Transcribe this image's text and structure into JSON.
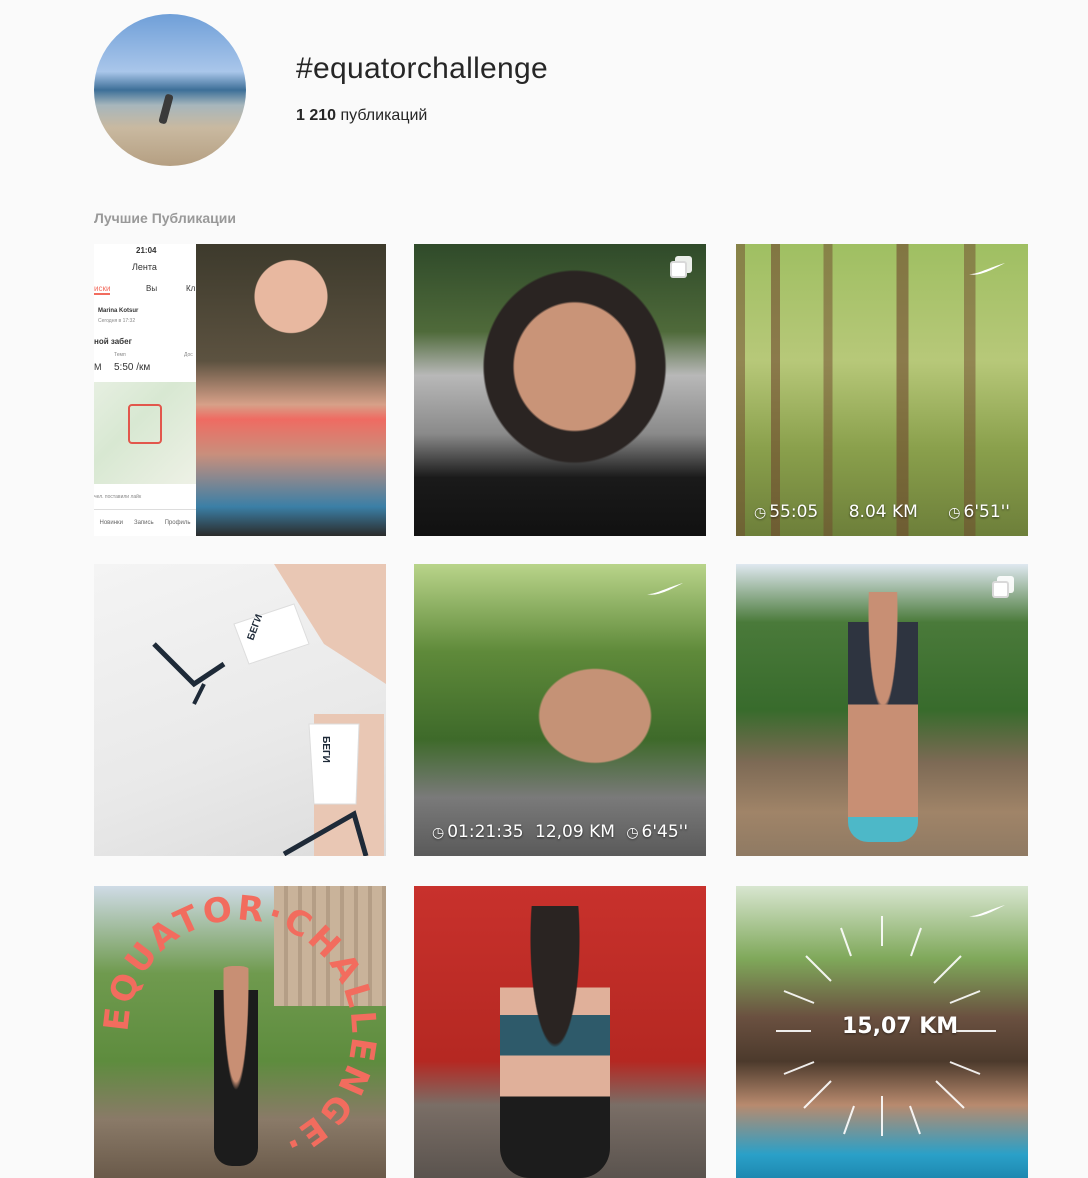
{
  "header": {
    "hashtag": "#equatorchallenge",
    "post_count": "1 210",
    "post_count_label": "публикаций"
  },
  "section": {
    "title": "Лучшие Публикации"
  },
  "posts": [
    {
      "phone": {
        "time": "21:04",
        "feed_tab": "Лента",
        "tabs": [
          "иски",
          "Вы",
          "Кл"
        ],
        "user": "Marina Kotsur",
        "date": "Сегодня в 17:32",
        "run_title": "ной забег",
        "pace_label": "Темп",
        "pace_unit_left": "М",
        "pace_value": "5:50 /км",
        "dist_label": "Дос",
        "likes_text": "чел. поставили лайк",
        "bottom_tabs": [
          "Новинки",
          "Запись",
          "Профиль"
        ]
      }
    },
    {
      "multi": true
    },
    {
      "stats": [
        "55:05",
        "8.04 KM",
        "6'51''"
      ]
    },
    {
      "sock_text": "БЕГИ"
    },
    {
      "stats": [
        "01:21:35",
        "12,09 KM",
        "6'45''"
      ]
    },
    {
      "multi": true
    },
    {
      "ring_text": "EQUATOR·CHALLENGE·"
    },
    {},
    {
      "overlay": "15,07 KM"
    }
  ],
  "colors": {
    "background": "#fafafa",
    "text": "#262626",
    "section_text": "#999999",
    "accent_coral": "#f26c5e"
  }
}
